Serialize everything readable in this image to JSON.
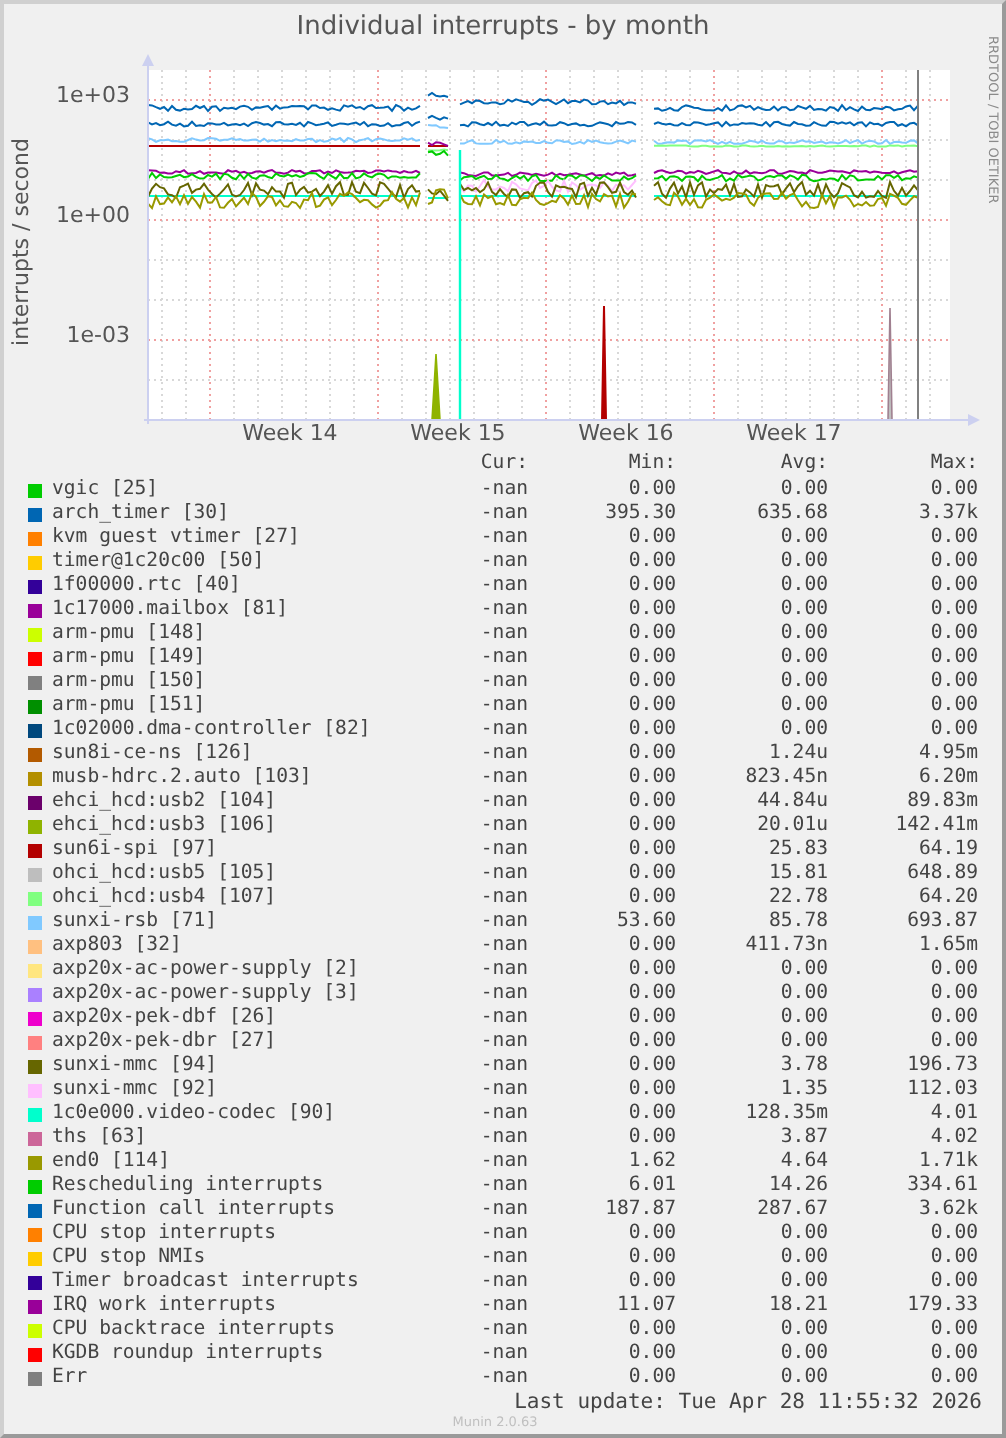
{
  "title": "Individual interrupts - by month",
  "side_credit": "RRDTOOL / TOBI OETIKER",
  "y_axis_label": "interrupts / second",
  "y_ticks": [
    "1e+03",
    "1e+00",
    "1e-03"
  ],
  "x_ticks": [
    "Week 14",
    "Week 15",
    "Week 16",
    "Week 17"
  ],
  "legend": {
    "columns": [
      "Cur:",
      "Min:",
      "Avg:",
      "Max:"
    ],
    "rows": [
      {
        "name": "vgic [25]",
        "color": "#00cc00",
        "cur": "-nan",
        "min": "0.00",
        "avg": "0.00",
        "max": "0.00"
      },
      {
        "name": "arch_timer [30]",
        "color": "#0066b3",
        "cur": "-nan",
        "min": "395.30",
        "avg": "635.68",
        "max": "3.37k"
      },
      {
        "name": "kvm guest vtimer [27]",
        "color": "#ff8000",
        "cur": "-nan",
        "min": "0.00",
        "avg": "0.00",
        "max": "0.00"
      },
      {
        "name": "timer@1c20c00 [50]",
        "color": "#ffcc00",
        "cur": "-nan",
        "min": "0.00",
        "avg": "0.00",
        "max": "0.00"
      },
      {
        "name": "1f00000.rtc [40]",
        "color": "#330099",
        "cur": "-nan",
        "min": "0.00",
        "avg": "0.00",
        "max": "0.00"
      },
      {
        "name": "1c17000.mailbox [81]",
        "color": "#990099",
        "cur": "-nan",
        "min": "0.00",
        "avg": "0.00",
        "max": "0.00"
      },
      {
        "name": "arm-pmu [148]",
        "color": "#ccff00",
        "cur": "-nan",
        "min": "0.00",
        "avg": "0.00",
        "max": "0.00"
      },
      {
        "name": "arm-pmu [149]",
        "color": "#ff0000",
        "cur": "-nan",
        "min": "0.00",
        "avg": "0.00",
        "max": "0.00"
      },
      {
        "name": "arm-pmu [150]",
        "color": "#808080",
        "cur": "-nan",
        "min": "0.00",
        "avg": "0.00",
        "max": "0.00"
      },
      {
        "name": "arm-pmu [151]",
        "color": "#008f00",
        "cur": "-nan",
        "min": "0.00",
        "avg": "0.00",
        "max": "0.00"
      },
      {
        "name": "1c02000.dma-controller [82]",
        "color": "#00487d",
        "cur": "-nan",
        "min": "0.00",
        "avg": "0.00",
        "max": "0.00"
      },
      {
        "name": "sun8i-ce-ns [126]",
        "color": "#b35a00",
        "cur": "-nan",
        "min": "0.00",
        "avg": "1.24u",
        "max": "4.95m"
      },
      {
        "name": "musb-hdrc.2.auto [103]",
        "color": "#b38f00",
        "cur": "-nan",
        "min": "0.00",
        "avg": "823.45n",
        "max": "6.20m"
      },
      {
        "name": "ehci_hcd:usb2 [104]",
        "color": "#6b006b",
        "cur": "-nan",
        "min": "0.00",
        "avg": "44.84u",
        "max": "89.83m"
      },
      {
        "name": "ehci_hcd:usb3 [106]",
        "color": "#8fb300",
        "cur": "-nan",
        "min": "0.00",
        "avg": "20.01u",
        "max": "142.41m"
      },
      {
        "name": "sun6i-spi [97]",
        "color": "#b30000",
        "cur": "-nan",
        "min": "0.00",
        "avg": "25.83",
        "max": "64.19"
      },
      {
        "name": "ohci_hcd:usb5 [105]",
        "color": "#bebebe",
        "cur": "-nan",
        "min": "0.00",
        "avg": "15.81",
        "max": "648.89"
      },
      {
        "name": "ohci_hcd:usb4 [107]",
        "color": "#80ff80",
        "cur": "-nan",
        "min": "0.00",
        "avg": "22.78",
        "max": "64.20"
      },
      {
        "name": "sunxi-rsb [71]",
        "color": "#80c9ff",
        "cur": "-nan",
        "min": "53.60",
        "avg": "85.78",
        "max": "693.87"
      },
      {
        "name": "axp803 [32]",
        "color": "#ffc080",
        "cur": "-nan",
        "min": "0.00",
        "avg": "411.73n",
        "max": "1.65m"
      },
      {
        "name": "axp20x-ac-power-supply [2]",
        "color": "#ffe680",
        "cur": "-nan",
        "min": "0.00",
        "avg": "0.00",
        "max": "0.00"
      },
      {
        "name": "axp20x-ac-power-supply [3]",
        "color": "#aa80ff",
        "cur": "-nan",
        "min": "0.00",
        "avg": "0.00",
        "max": "0.00"
      },
      {
        "name": "axp20x-pek-dbf [26]",
        "color": "#ee00cc",
        "cur": "-nan",
        "min": "0.00",
        "avg": "0.00",
        "max": "0.00"
      },
      {
        "name": "axp20x-pek-dbr [27]",
        "color": "#ff8080",
        "cur": "-nan",
        "min": "0.00",
        "avg": "0.00",
        "max": "0.00"
      },
      {
        "name": "sunxi-mmc [94]",
        "color": "#666600",
        "cur": "-nan",
        "min": "0.00",
        "avg": "3.78",
        "max": "196.73"
      },
      {
        "name": "sunxi-mmc [92]",
        "color": "#ffbfff",
        "cur": "-nan",
        "min": "0.00",
        "avg": "1.35",
        "max": "112.03"
      },
      {
        "name": "1c0e000.video-codec [90]",
        "color": "#00ffcc",
        "cur": "-nan",
        "min": "0.00",
        "avg": "128.35m",
        "max": "4.01"
      },
      {
        "name": "ths [63]",
        "color": "#cc6699",
        "cur": "-nan",
        "min": "0.00",
        "avg": "3.87",
        "max": "4.02"
      },
      {
        "name": "end0 [114]",
        "color": "#999900",
        "cur": "-nan",
        "min": "1.62",
        "avg": "4.64",
        "max": "1.71k"
      },
      {
        "name": "Rescheduling interrupts",
        "color": "#00cc00",
        "cur": "-nan",
        "min": "6.01",
        "avg": "14.26",
        "max": "334.61"
      },
      {
        "name": "Function call interrupts",
        "color": "#0066b3",
        "cur": "-nan",
        "min": "187.87",
        "avg": "287.67",
        "max": "3.62k"
      },
      {
        "name": "CPU stop interrupts",
        "color": "#ff8000",
        "cur": "-nan",
        "min": "0.00",
        "avg": "0.00",
        "max": "0.00"
      },
      {
        "name": "CPU stop NMIs",
        "color": "#ffcc00",
        "cur": "-nan",
        "min": "0.00",
        "avg": "0.00",
        "max": "0.00"
      },
      {
        "name": "Timer broadcast interrupts",
        "color": "#330099",
        "cur": "-nan",
        "min": "0.00",
        "avg": "0.00",
        "max": "0.00"
      },
      {
        "name": "IRQ work interrupts",
        "color": "#990099",
        "cur": "-nan",
        "min": "11.07",
        "avg": "18.21",
        "max": "179.33"
      },
      {
        "name": "CPU backtrace interrupts",
        "color": "#ccff00",
        "cur": "-nan",
        "min": "0.00",
        "avg": "0.00",
        "max": "0.00"
      },
      {
        "name": "KGDB roundup interrupts",
        "color": "#ff0000",
        "cur": "-nan",
        "min": "0.00",
        "avg": "0.00",
        "max": "0.00"
      },
      {
        "name": "Err",
        "color": "#808080",
        "cur": "-nan",
        "min": "0.00",
        "avg": "0.00",
        "max": "0.00"
      }
    ]
  },
  "last_update": "Last update: Tue Apr 28 11:55:32 2026",
  "footer": "Munin 2.0.63"
}
